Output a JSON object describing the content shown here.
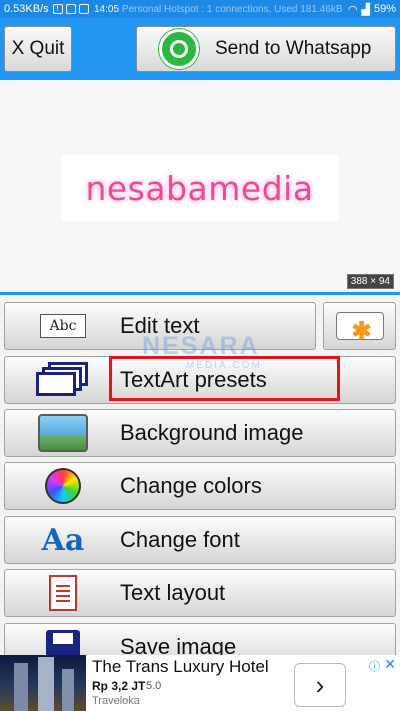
{
  "status_bar": {
    "speed": "0.53KB/s",
    "time": "14:05",
    "notification": "Personal Hotspot : 1 connections, Used 181.46kB",
    "battery": "59%"
  },
  "top_bar": {
    "quit_label": "X Quit",
    "whatsapp_label": "Send to Whatsapp"
  },
  "preview": {
    "text_art": "nesabamedia",
    "size": "388 × 94"
  },
  "menu": {
    "edit_text": "Edit text",
    "abc_icon_text": "Abc",
    "presets": "TextArt presets",
    "background": "Background image",
    "colors": "Change colors",
    "font": "Change font",
    "font_icon_text": "Aa",
    "layout": "Text layout",
    "save": "Save image"
  },
  "watermark": {
    "main": "NESARA",
    "sub": "MEDIA.COM"
  },
  "ad": {
    "title": "The Trans Luxury Hotel",
    "price": "Rp 3,2 JT",
    "rating": "5.0",
    "brand": "Traveloka",
    "arrow": "›",
    "info": "ⓘ",
    "close": "✕"
  },
  "colors": {
    "accent": "#2196f3",
    "highlight": "#e5121f",
    "text_art": "#e84c98"
  }
}
